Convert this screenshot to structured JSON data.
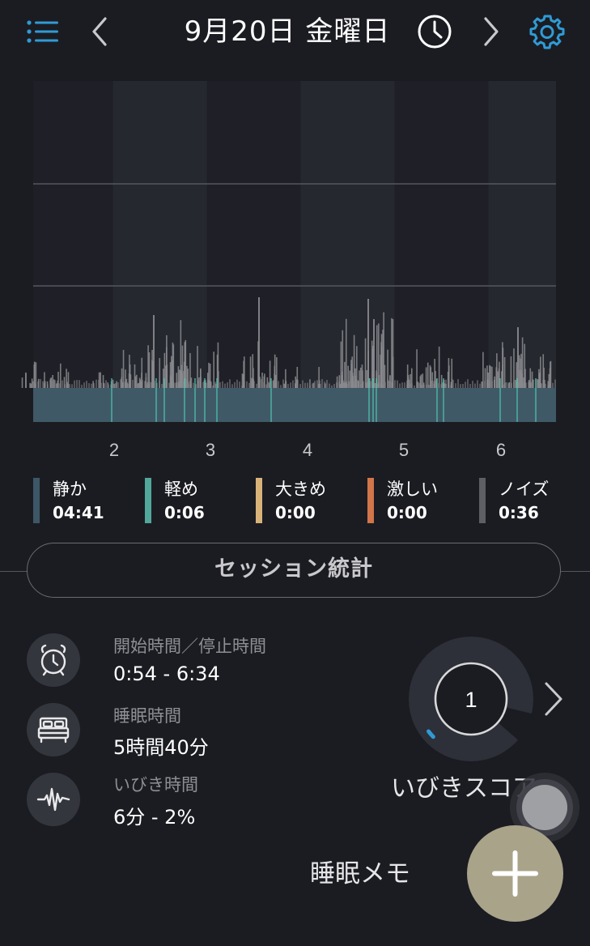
{
  "header": {
    "date_title": "9月20日 金曜日",
    "icons": [
      "list-menu-icon",
      "chevron-left-icon",
      "clock-icon",
      "chevron-right-icon",
      "gear-icon"
    ],
    "accent_color": "#2f9bd6"
  },
  "chart_data": {
    "type": "area",
    "x_tick_labels": [
      "2",
      "3",
      "4",
      "5",
      "6"
    ],
    "x_range_hours": [
      1.0,
      6.57
    ],
    "baseline_color": "#3f5a66",
    "light_snore_color": "#52c7b5",
    "noise_color": "#8a8b8f",
    "grid_lines": 2,
    "series": [
      {
        "name": "静か",
        "value": "04:41",
        "color": "#3d5766"
      },
      {
        "name": "軽め",
        "value": "0:06",
        "color": "#52a79b"
      },
      {
        "name": "大きめ",
        "value": "0:00",
        "color": "#d9b27a"
      },
      {
        "name": "激しい",
        "value": "0:00",
        "color": "#d2754a"
      },
      {
        "name": "ノイズ",
        "value": "0:36",
        "color": "#5e5f64"
      }
    ]
  },
  "session": {
    "button_label": "セッション統計"
  },
  "stats": [
    {
      "icon": "alarm-clock-icon",
      "label": "開始時間／停止時間",
      "value": "0:54 - 6:34"
    },
    {
      "icon": "bed-icon",
      "label": "睡眠時間",
      "value": "5時間40分"
    },
    {
      "icon": "waveform-icon",
      "label": "いびき時間",
      "value": "6分 - 2%"
    }
  ],
  "score": {
    "value": "1",
    "label": "いびきスコア",
    "gauge_fraction": 0.01
  },
  "memo": {
    "label": "睡眠メモ",
    "add_icon": "plus-icon"
  }
}
